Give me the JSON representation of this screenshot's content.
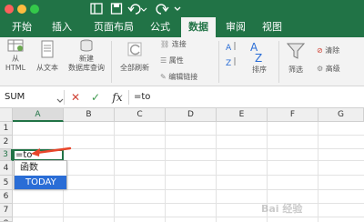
{
  "tabs": [
    {
      "label": "开始",
      "active": false
    },
    {
      "label": "插入",
      "active": false
    },
    {
      "label": "页面布局",
      "active": false
    },
    {
      "label": "公式",
      "active": false
    },
    {
      "label": "数据",
      "active": true
    },
    {
      "label": "审阅",
      "active": false
    },
    {
      "label": "视图",
      "active": false
    }
  ],
  "ribbon": {
    "from_html": [
      "从",
      "HTML"
    ],
    "from_text": "从文本",
    "new_query": [
      "新建",
      "数据库查询"
    ],
    "refresh_all": "全部刷新",
    "connections": "连接",
    "properties": "属性",
    "edit_links": "编辑链接",
    "sort": "排序",
    "filter": "筛选",
    "clear": "清除",
    "advanced": "高级"
  },
  "formula_bar": {
    "name_box": "SUM",
    "cancel_symbol": "✕",
    "enter_symbol": "✓",
    "fx_symbol": "fx",
    "formula": "=to"
  },
  "columns": [
    "A",
    "B",
    "C",
    "D",
    "E",
    "F",
    "G"
  ],
  "rows": [
    "1",
    "2",
    "3",
    "4",
    "5",
    "6",
    "7",
    "8"
  ],
  "active_cell": {
    "ref": "A3",
    "value": "=to"
  },
  "autocomplete": {
    "items": [
      {
        "label": "函数",
        "selected": false
      },
      {
        "label": "TODAY",
        "selected": true
      }
    ]
  },
  "colors": {
    "brand_green": "#217346",
    "arrow": "#e8462b",
    "selection_blue": "#2a6dd6",
    "cancel_red": "#d04437",
    "enter_green": "#3f9a4f"
  },
  "watermark": "Bai 经验"
}
